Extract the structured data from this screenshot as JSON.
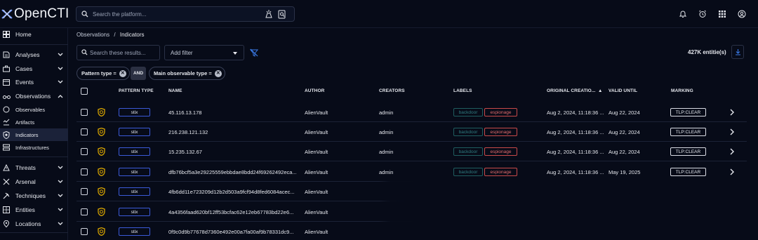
{
  "app": {
    "logo_text": "OpenCTI",
    "search_placeholder": "Search the platform..."
  },
  "colors": {
    "background": "#070b18",
    "accent_blue": "#3b5ad8",
    "label_backdoor": "#2f7d80",
    "label_espionage": "#e46a6a",
    "indicator_icon": "#d6a300"
  },
  "sidebar": {
    "items": [
      {
        "label": "Home",
        "icon": "dashboard-icon",
        "chevron": ""
      },
      {
        "label": "Analyses",
        "icon": "analyses-icon",
        "chevron": "down"
      },
      {
        "label": "Cases",
        "icon": "cases-icon",
        "chevron": "down"
      },
      {
        "label": "Events",
        "icon": "events-icon",
        "chevron": "down"
      },
      {
        "label": "Observations",
        "icon": "observations-icon",
        "chevron": "up"
      },
      {
        "label": "Observables",
        "icon": "observables-icon",
        "chevron": "",
        "sub": true
      },
      {
        "label": "Artifacts",
        "icon": "artifacts-icon",
        "chevron": "",
        "sub": true
      },
      {
        "label": "Indicators",
        "icon": "indicators-icon",
        "chevron": "",
        "sub": true,
        "active": true
      },
      {
        "label": "Infrastructures",
        "icon": "infrastructures-icon",
        "chevron": "",
        "sub": true
      },
      {
        "label": "Threats",
        "icon": "threats-icon",
        "chevron": "down"
      },
      {
        "label": "Arsenal",
        "icon": "arsenal-icon",
        "chevron": "down"
      },
      {
        "label": "Techniques",
        "icon": "techniques-icon",
        "chevron": "down"
      },
      {
        "label": "Entities",
        "icon": "entities-icon",
        "chevron": "down"
      },
      {
        "label": "Locations",
        "icon": "locations-icon",
        "chevron": "down"
      }
    ]
  },
  "breadcrumb": {
    "parent": "Observations",
    "separator": "/",
    "current": "Indicators"
  },
  "toolbar": {
    "search_placeholder": "Search these results...",
    "add_filter": "Add filter",
    "entity_count": "427K entitie(s)"
  },
  "filters": {
    "chip1": "Pattern type =",
    "operator": "AND",
    "chip2": "Main observable type ="
  },
  "table": {
    "columns": [
      "PATTERN TYPE",
      "NAME",
      "AUTHOR",
      "CREATORS",
      "LABELS",
      "ORIGINAL CREATIO...",
      "VALID UNTIL",
      "MARKING"
    ],
    "sort_indicator": "▲",
    "rows": [
      {
        "pattern": "stix",
        "name": "45.116.13.178",
        "author": "AlienVault",
        "creator": "admin",
        "labels": [
          "backdoor",
          "espionage"
        ],
        "created": "Aug 2, 2024, 11:18:36 ...",
        "valid_until": "Aug 22, 2024",
        "marking": "TLP:CLEAR"
      },
      {
        "pattern": "stix",
        "name": "216.238.121.132",
        "author": "AlienVault",
        "creator": "admin",
        "labels": [
          "backdoor",
          "espionage"
        ],
        "created": "Aug 2, 2024, 11:18:36 ...",
        "valid_until": "Aug 22, 2024",
        "marking": "TLP:CLEAR"
      },
      {
        "pattern": "stix",
        "name": "15.235.132.67",
        "author": "AlienVault",
        "creator": "admin",
        "labels": [
          "backdoor",
          "espionage"
        ],
        "created": "Aug 2, 2024, 11:18:36 ...",
        "valid_until": "Aug 22, 2024",
        "marking": "TLP:CLEAR"
      },
      {
        "pattern": "stix",
        "name": "dfb76bcf5a3e29225559ebbdae8bdd24f69262492eca...",
        "author": "AlienVault",
        "creator": "admin",
        "labels": [
          "backdoor",
          "espionage"
        ],
        "created": "Aug 2, 2024, 11:18:36 ...",
        "valid_until": "May 19, 2025",
        "marking": "TLP:CLEAR"
      },
      {
        "pattern": "stix",
        "name": "4fb6dd11e723209d12b2d503a9fcf94d8fed6084acec...",
        "author": "AlienVault",
        "creator": "",
        "labels": [],
        "created": "",
        "valid_until": "",
        "marking": ""
      },
      {
        "pattern": "stix",
        "name": "4a4356faad620bf12ff53bcfac62e12eb67783bd22e6...",
        "author": "AlienVault",
        "creator": "",
        "labels": [],
        "created": "",
        "valid_until": "",
        "marking": ""
      },
      {
        "pattern": "stix",
        "name": "0f9c0d9b77678d7360e492e00a7fa00af9b78331dc9...",
        "author": "AlienVault",
        "creator": "",
        "labels": [],
        "created": "",
        "valid_until": "",
        "marking": ""
      }
    ]
  }
}
